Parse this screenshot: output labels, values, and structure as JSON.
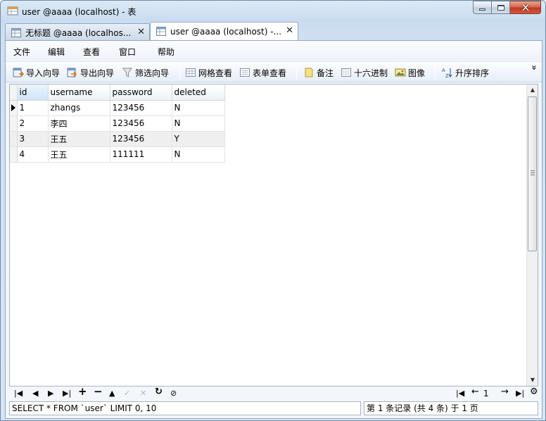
{
  "window": {
    "title": "user @aaaa (localhost) - 表"
  },
  "tabs": [
    {
      "label": "无标题 @aaaa (localhos...",
      "close": "✕"
    },
    {
      "label": "user @aaaa (localhost) -...",
      "close": "✕"
    }
  ],
  "menu": [
    "文件",
    "编辑",
    "查看",
    "窗口",
    "帮助"
  ],
  "toolbar": {
    "import": "导入向导",
    "export": "导出向导",
    "filter": "筛选向导",
    "grid_view": "网格查看",
    "form_view": "表单查看",
    "memo": "备注",
    "hex": "十六进制",
    "image": "图像",
    "sort": "升序排序",
    "more": "»"
  },
  "table": {
    "columns": [
      "id",
      "username",
      "password",
      "deleted"
    ],
    "rows": [
      [
        "1",
        "zhangs",
        "123456",
        "N"
      ],
      [
        "2",
        "李四",
        "123456",
        "N"
      ],
      [
        "3",
        "王五",
        "123456",
        "Y"
      ],
      [
        "4",
        "王五",
        "111111",
        "N"
      ]
    ]
  },
  "nav": {
    "page": "1"
  },
  "status": {
    "sql": "SELECT * FROM `user` LIMIT 0, 10",
    "records": "第 1 条记录 (共 4 条) 于 1 页"
  },
  "colors": {
    "title_gradient_top": "#dce9f6",
    "close_button": "#c2381d",
    "selected_header": "#cfe5f8",
    "alt_row": "#efefef"
  },
  "icons": {
    "app": "table-icon",
    "tab": "table-icon",
    "import": "import-wizard-icon",
    "export": "export-wizard-icon",
    "filter": "funnel-icon",
    "grid": "grid-icon",
    "form": "form-icon",
    "memo": "note-icon",
    "hex": "hex-icon",
    "image": "image-icon",
    "sort": "sort-ascending-icon"
  }
}
